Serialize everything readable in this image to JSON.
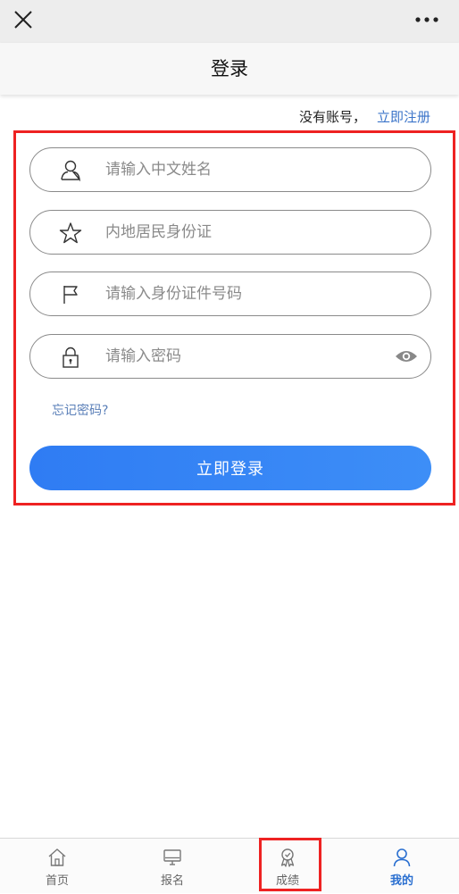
{
  "page": {
    "title": "登录"
  },
  "register": {
    "question": "没有账号，",
    "link": "立即注册"
  },
  "form": {
    "name_placeholder": "请输入中文姓名",
    "idtype_placeholder": "内地居民身份证",
    "idnumber_placeholder": "请输入身份证件号码",
    "password_placeholder": "请输入密码",
    "forgot_label": "忘记密码?",
    "login_label": "立即登录"
  },
  "tabbar": {
    "items": [
      {
        "label": "首页",
        "icon": "home-icon"
      },
      {
        "label": "报名",
        "icon": "monitor-icon"
      },
      {
        "label": "成绩",
        "icon": "award-icon"
      },
      {
        "label": "我的",
        "icon": "user-icon",
        "active": true
      }
    ]
  },
  "colors": {
    "accent": "#2f7cf3",
    "link": "#3b74c9",
    "highlight": "#ee2222"
  }
}
